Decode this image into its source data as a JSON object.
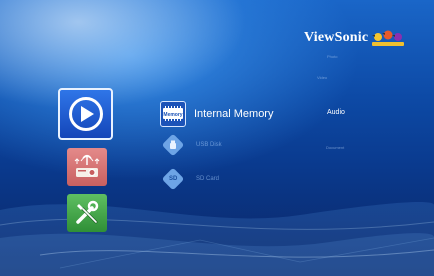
{
  "brand": {
    "logo_text": "ViewSonic"
  },
  "main_menu": [
    {
      "id": "media",
      "icon": "play-icon"
    },
    {
      "id": "connection",
      "icon": "projector-wireless-icon"
    },
    {
      "id": "settings",
      "icon": "tools-icon"
    }
  ],
  "sources": [
    {
      "label": "Internal Memory",
      "icon": "memory-chip-icon",
      "icon_text": "Memory",
      "selected": true
    },
    {
      "label": "USB Disk",
      "icon": "usb-icon",
      "selected": false
    },
    {
      "label": "SD Card",
      "icon": "sd-card-icon",
      "icon_text": "SD",
      "selected": false
    }
  ],
  "categories": [
    {
      "label": "Photo",
      "selected": false
    },
    {
      "label": "Video",
      "selected": false
    },
    {
      "label": "Audio",
      "selected": true
    },
    {
      "label": "Document",
      "selected": false
    }
  ],
  "colors": {
    "accent": "#1c53b8",
    "background": "#0d4aa6",
    "selected_text": "#ffffff"
  }
}
